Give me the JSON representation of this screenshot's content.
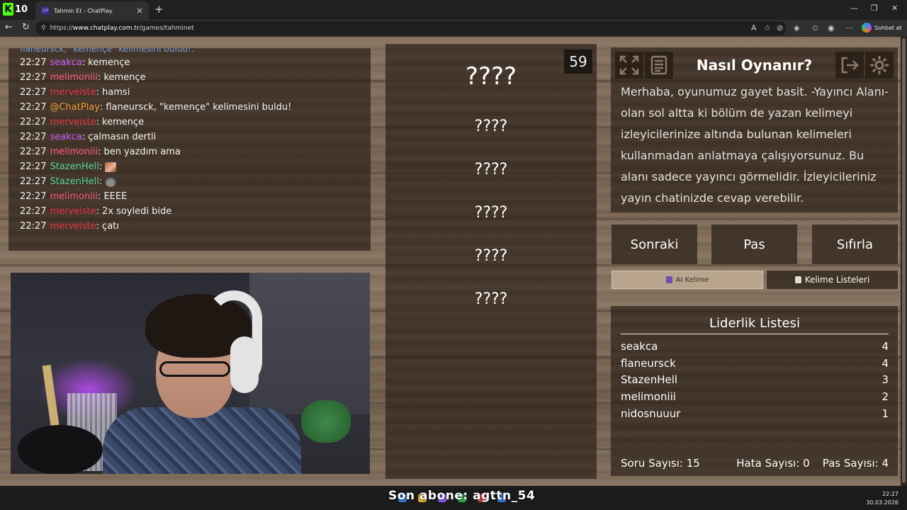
{
  "browser": {
    "badge": "10",
    "tab_favicon": "CP",
    "tab_title": "Tahmin Et - ChatPlay",
    "url_prefix": "https://",
    "url_domain": "www.chatplay.com.tr",
    "url_path": "/games/tahminet",
    "copilot_label": "Sohbet et"
  },
  "chat": {
    "partial_top": "flaneursck, \"kemençe\" kelimesini buldu!.",
    "messages": [
      {
        "time": "22:27",
        "user": "seakca",
        "color": "#c65cff",
        "text": "kemençe"
      },
      {
        "time": "22:27",
        "user": "melimoniii",
        "color": "#ff5a8a",
        "text": "kemençe"
      },
      {
        "time": "22:27",
        "user": "merveiste",
        "color": "#e8334a",
        "text": "hamsi"
      },
      {
        "time": "22:27",
        "user": "@ChatPlay",
        "color": "#f0a030",
        "text": "flaneursck, \"kemençe\" kelimesini buldu!"
      },
      {
        "time": "22:27",
        "user": "merveiste",
        "color": "#e8334a",
        "text": "kemençe"
      },
      {
        "time": "22:27",
        "user": "seakca",
        "color": "#c65cff",
        "text": "çalmasın dertli"
      },
      {
        "time": "22:27",
        "user": "melimoniii",
        "color": "#ff5a8a",
        "text": "ben yazdım ama"
      },
      {
        "time": "22:27",
        "user": "StazenHell",
        "color": "#5ad6a0",
        "text": "",
        "emote": "a"
      },
      {
        "time": "22:27",
        "user": "StazenHell",
        "color": "#5ad6a0",
        "text": "",
        "emote": "b"
      },
      {
        "time": "22:27",
        "user": "melimoniii",
        "color": "#ff5a8a",
        "text": "EEEE"
      },
      {
        "time": "22:27",
        "user": "merveiste",
        "color": "#e8334a",
        "text": "2x soyledi bide"
      },
      {
        "time": "22:27",
        "user": "merveiste",
        "color": "#e8334a",
        "text": "çatı"
      }
    ]
  },
  "game": {
    "timer": "59",
    "main_word": "????",
    "words": [
      "????",
      "????",
      "????",
      "????",
      "????"
    ]
  },
  "howto": {
    "title": "Nasıl Oynanır?",
    "body": "Merhaba, oyunumuz gayet basit. -Yayıncı Alanı- olan sol altta ki bölüm de yazan kelimeyi izleyicilerinize altında bulunan kelimeleri kullanmadan anlatmaya çalışıyorsunuz. Bu alanı sadece yayıncı görmelidir. İzleyicileriniz yayın chatinizde cevap verebilir.",
    "icons": [
      "fullscreen-icon",
      "notes-icon",
      "exit-icon",
      "settings-icon"
    ]
  },
  "actions": {
    "next": "Sonraki",
    "pass": "Pas",
    "reset": "Sıfırla",
    "ai_word": "AI Kelime",
    "word_lists": "Kelime Listeleri"
  },
  "leaderboard": {
    "title": "Liderlik Listesi",
    "rows": [
      {
        "name": "seakca",
        "score": "4"
      },
      {
        "name": "flaneursck",
        "score": "4"
      },
      {
        "name": "StazenHell",
        "score": "3"
      },
      {
        "name": "melimoniii",
        "score": "2"
      },
      {
        "name": "nidosnuuur",
        "score": "1"
      }
    ],
    "questions_label": "Soru Sayısı:",
    "questions_value": "15",
    "errors_label": "Hata Sayısı:",
    "errors_value": "0",
    "passes_label": "Pas Sayısı:",
    "passes_value": "4"
  },
  "taskbar": {
    "overlay": "Son abone: agttn_54",
    "time": "22:27",
    "date": "30.03.2026"
  }
}
